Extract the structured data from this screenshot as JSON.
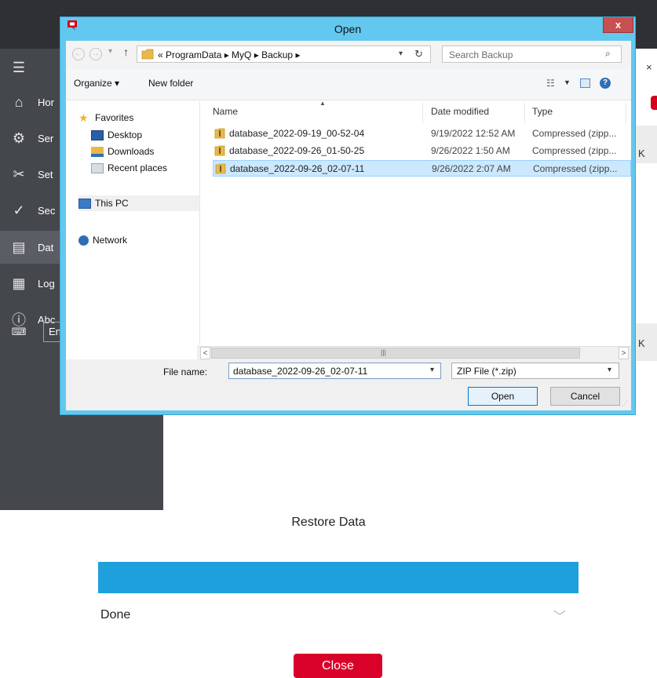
{
  "app": {
    "sidebar_items": [
      {
        "icon": "home-icon",
        "glyph": "⌂",
        "label": "Hor"
      },
      {
        "icon": "gear-icon",
        "glyph": "⚙",
        "label": "Ser"
      },
      {
        "icon": "tools-icon",
        "glyph": "✂",
        "label": "Set"
      },
      {
        "icon": "shield-check-icon",
        "glyph": "✓",
        "label": "Sec"
      },
      {
        "icon": "database-icon",
        "glyph": "▤",
        "label": "Dat"
      },
      {
        "icon": "log-icon",
        "glyph": "▦",
        "label": "Log"
      },
      {
        "icon": "info-icon",
        "glyph": "ⓘ",
        "label": "Abc"
      }
    ],
    "language_value": "En",
    "right_fragment_1": "K",
    "right_fragment_2": "K",
    "right_fragment_top": "×",
    "restore_title": "Restore Data",
    "progress_percent": 100,
    "progress_color": "#1ea0dc",
    "status": "Done",
    "close_label": "Close",
    "close_color": "#d9002a"
  },
  "dialog": {
    "title": "Open",
    "close_glyph": "x",
    "address_path": "« ProgramData ▸ MyQ ▸ Backup ▸",
    "search_placeholder": "Search Backup",
    "toolbar": {
      "organize": "Organize ▾",
      "new_folder": "New folder"
    },
    "nav_pane": {
      "favorites": "Favorites",
      "desktop": "Desktop",
      "downloads": "Downloads",
      "recent": "Recent places",
      "this_pc": "This PC",
      "network": "Network"
    },
    "columns": {
      "name": "Name",
      "date": "Date modified",
      "type": "Type"
    },
    "files": [
      {
        "name": "database_2022-09-19_00-52-04",
        "date": "9/19/2022 12:52 AM",
        "type": "Compressed (zipp..."
      },
      {
        "name": "database_2022-09-26_01-50-25",
        "date": "9/26/2022 1:50 AM",
        "type": "Compressed (zipp..."
      },
      {
        "name": "database_2022-09-26_02-07-11",
        "date": "9/26/2022 2:07 AM",
        "type": "Compressed (zipp..."
      }
    ],
    "selected_file_index": 2,
    "file_name_label": "File name:",
    "file_name_value": "database_2022-09-26_02-07-11",
    "file_type_value": "ZIP File (*.zip)",
    "open_label": "Open",
    "cancel_label": "Cancel"
  }
}
